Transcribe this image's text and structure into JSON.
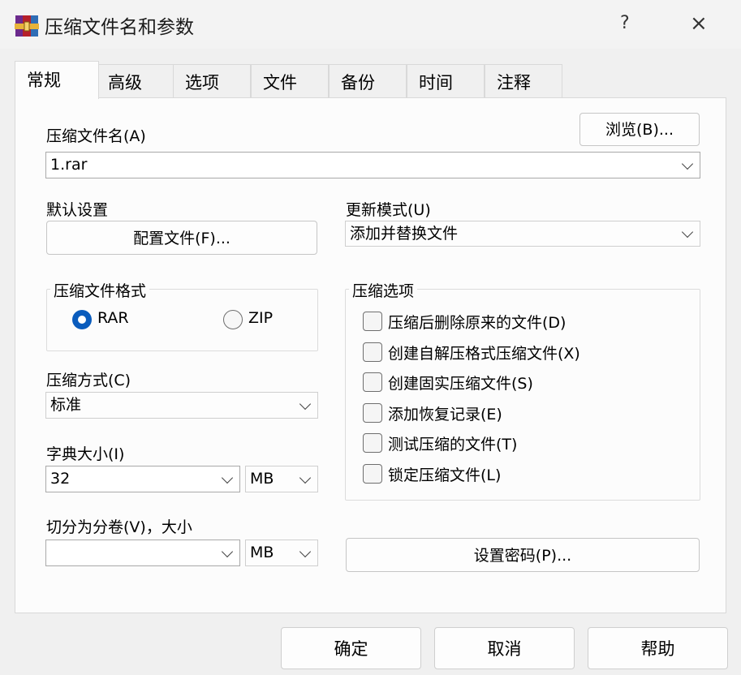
{
  "window": {
    "title": "压缩文件名和参数",
    "help": "?",
    "close": "×"
  },
  "tabs": [
    "常规",
    "高级",
    "选项",
    "文件",
    "备份",
    "时间",
    "注释"
  ],
  "archive": {
    "label": "压缩文件名(A)",
    "value": "1.rar",
    "browse": "浏览(B)..."
  },
  "defaults": {
    "label": "默认设置",
    "profiles_button": "配置文件(F)..."
  },
  "update_mode": {
    "label": "更新模式(U)",
    "value": "添加并替换文件"
  },
  "format": {
    "legend": "压缩文件格式",
    "options": [
      {
        "label": "RAR",
        "selected": true
      },
      {
        "label": "ZIP",
        "selected": false
      }
    ]
  },
  "method": {
    "label": "压缩方式(C)",
    "value": "标准"
  },
  "dictionary": {
    "label": "字典大小(I)",
    "value": "32",
    "unit": "MB"
  },
  "split": {
    "label": "切分为分卷(V)，大小",
    "value": "",
    "unit": "MB"
  },
  "options": {
    "legend": "压缩选项",
    "items": [
      {
        "label": "压缩后删除原来的文件(D)",
        "checked": false
      },
      {
        "label": "创建自解压格式压缩文件(X)",
        "checked": false
      },
      {
        "label": "创建固实压缩文件(S)",
        "checked": false
      },
      {
        "label": "添加恢复记录(E)",
        "checked": false
      },
      {
        "label": "测试压缩的文件(T)",
        "checked": false
      },
      {
        "label": "锁定压缩文件(L)",
        "checked": false
      }
    ]
  },
  "password_button": "设置密码(P)...",
  "footer": {
    "ok": "确定",
    "cancel": "取消",
    "help": "帮助"
  },
  "icons": {
    "app": "winrar-books-icon"
  },
  "colors": {
    "accent": "#0a5cbd",
    "icon_red": "#b5202a",
    "icon_gold": "#e8b33a"
  }
}
